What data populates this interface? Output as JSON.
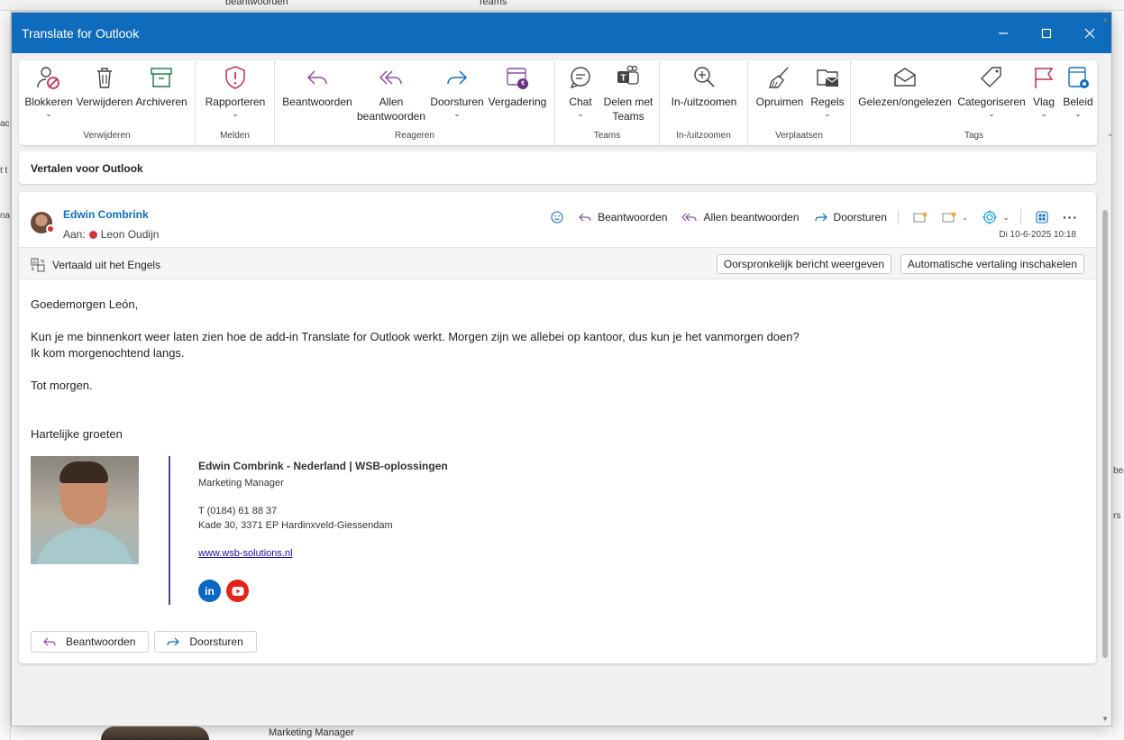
{
  "background": {
    "top_items": [
      "beantwoorden",
      "Teams"
    ],
    "left_items": [
      "acc",
      "t t",
      "nar"
    ],
    "right_items": [
      "bea",
      "rs"
    ],
    "bottom_text": "Marketing Manager"
  },
  "window": {
    "title": "Translate for Outlook"
  },
  "ribbon": {
    "groups": [
      {
        "label": "Verwijderen",
        "buttons": [
          "Blokkeren",
          "Verwijderen",
          "Archiveren"
        ]
      },
      {
        "label": "Melden",
        "buttons": [
          "Rapporteren"
        ]
      },
      {
        "label": "Reageren",
        "buttons": [
          "Beantwoorden",
          "Allen beantwoorden",
          "Doorsturen",
          "Vergadering"
        ]
      },
      {
        "label": "Teams",
        "buttons": [
          "Chat",
          "Delen met Teams"
        ]
      },
      {
        "label": "In-/uitzoomen",
        "buttons": [
          "In-/uitzoomen"
        ]
      },
      {
        "label": "Verplaatsen",
        "buttons": [
          "Opruimen",
          "Regels"
        ]
      },
      {
        "label": "Tags",
        "buttons": [
          "Gelezen/ongelezen",
          "Categoriseren",
          "Vlag",
          "Beleid"
        ]
      }
    ]
  },
  "addin_pane": {
    "title": "Vertalen voor Outlook"
  },
  "message": {
    "sender": "Edwin Combrink",
    "to_label": "Aan:",
    "recipient": "Leon Oudijn",
    "date": "Di 10-6-2025 10:18",
    "actions": {
      "reply": "Beantwoorden",
      "reply_all": "Allen beantwoorden",
      "forward": "Doorsturen"
    },
    "translation": {
      "label": "Vertaald uit het Engels",
      "show_original": "Oorspronkelijk bericht weergeven",
      "auto_translate": "Automatische vertaling inschakelen"
    },
    "body": {
      "greeting": "Goedemorgen León,",
      "line1": "Kun je me binnenkort weer laten zien hoe de add-in Translate for Outlook werkt. Morgen zijn we allebei op kantoor, dus kun je het vanmorgen doen?",
      "line2": "Ik kom morgenochtend langs.",
      "closing": "Tot morgen.",
      "regards": "Hartelijke groeten"
    },
    "signature": {
      "name": "Edwin Combrink - Nederland | WSB-oplossingen",
      "role": "Marketing Manager",
      "phone": "T (0184) 61 88 37",
      "address": "Kade 30, 3371 EP Hardinxveld-Giessendam",
      "website": "www.wsb-solutions.nl",
      "linkedin_color": "#0a66c2",
      "youtube_color": "#e62117"
    },
    "bottom_buttons": {
      "reply": "Beantwoorden",
      "forward": "Doorsturen"
    }
  },
  "colors": {
    "titlebar": "#0f6cbd",
    "sender": "#0f6cbd",
    "accent_red": "#d13438",
    "signature_divider": "#5b3d8a"
  }
}
